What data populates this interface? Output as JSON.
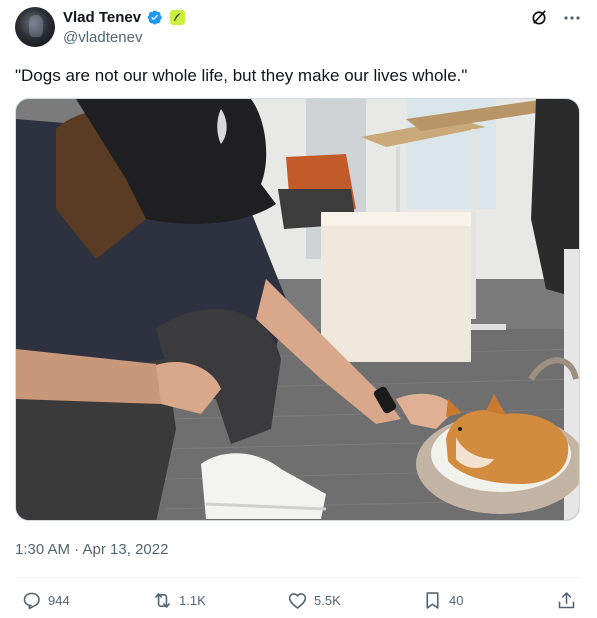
{
  "author": {
    "display_name": "Vlad Tenev",
    "handle": "@vladtenev",
    "avatar_icon": "avatar"
  },
  "tweet": {
    "text": "\"Dogs are not our whole life, but they make our lives whole.\"",
    "timestamp": "1:30 AM · Apr 13, 2022"
  },
  "engagement": {
    "replies": "944",
    "reposts": "1.1K",
    "likes": "5.5K",
    "bookmarks": "40"
  },
  "colors": {
    "verified_badge": "#1d9bf0",
    "affiliate_badge": "#c9f03f",
    "secondary_text": "#536471"
  },
  "icons": {
    "verified": "verified-badge-icon",
    "affiliate": "affiliate-badge-icon",
    "grok": "grok-icon",
    "more": "more-icon",
    "reply": "reply-icon",
    "repost": "repost-icon",
    "like": "like-icon",
    "bookmark": "bookmark-icon",
    "share": "share-icon"
  }
}
